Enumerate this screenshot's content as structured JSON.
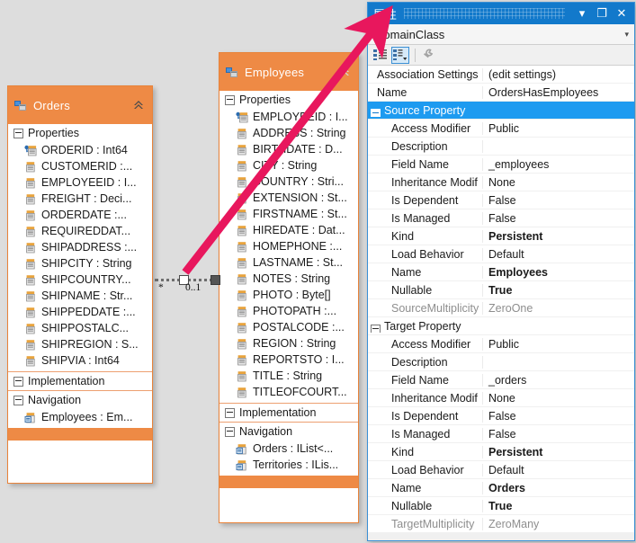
{
  "canvas": {
    "background": "#dddddd",
    "accent_orange": "#ee8a45",
    "accent_blue": "#1279cb",
    "annotation_arrow_color": "#e8175d"
  },
  "orders_class": {
    "title": "Orders",
    "header_icon": "domain-class-icon",
    "collapse_icon": "chevron-double-up-icon",
    "compartments": [
      {
        "label": "Properties",
        "rows": [
          {
            "icon": "key-property-icon",
            "text": "ORDERID : Int64"
          },
          {
            "icon": "property-icon",
            "text": "CUSTOMERID :..."
          },
          {
            "icon": "property-icon",
            "text": "EMPLOYEEID : I..."
          },
          {
            "icon": "property-icon",
            "text": "FREIGHT : Deci..."
          },
          {
            "icon": "property-icon",
            "text": "ORDERDATE  :..."
          },
          {
            "icon": "property-icon",
            "text": "REQUIREDDAT..."
          },
          {
            "icon": "property-icon",
            "text": "SHIPADDRESS  :..."
          },
          {
            "icon": "property-icon",
            "text": "SHIPCITY : String"
          },
          {
            "icon": "property-icon",
            "text": "SHIPCOUNTRY..."
          },
          {
            "icon": "property-icon",
            "text": "SHIPNAME : Str..."
          },
          {
            "icon": "property-icon",
            "text": "SHIPPEDDATE  :..."
          },
          {
            "icon": "property-icon",
            "text": "SHIPPOSTALC..."
          },
          {
            "icon": "property-icon",
            "text": "SHIPREGION : S..."
          },
          {
            "icon": "property-icon",
            "text": "SHIPVIA : Int64"
          }
        ]
      },
      {
        "label": "Implementation",
        "rows": []
      },
      {
        "label": "Navigation",
        "rows": [
          {
            "icon": "navigation-property-icon",
            "text": "Employees : Em..."
          }
        ]
      }
    ]
  },
  "employees_class": {
    "title": "Employees",
    "header_icon": "domain-class-icon",
    "collapse_icon": "chevron-double-up-icon",
    "compartments": [
      {
        "label": "Properties",
        "rows": [
          {
            "icon": "key-property-icon",
            "text": "EMPLOYEEID : I..."
          },
          {
            "icon": "property-icon",
            "text": "ADDRESS : String"
          },
          {
            "icon": "property-icon",
            "text": "BIRTHDATE : D..."
          },
          {
            "icon": "property-icon",
            "text": "CITY : String"
          },
          {
            "icon": "property-icon",
            "text": "COUNTRY : Stri..."
          },
          {
            "icon": "property-icon",
            "text": "EXTENSION : St..."
          },
          {
            "icon": "property-icon",
            "text": "FIRSTNAME : St..."
          },
          {
            "icon": "property-icon",
            "text": "HIREDATE  : Dat..."
          },
          {
            "icon": "property-icon",
            "text": "HOMEPHONE  :..."
          },
          {
            "icon": "property-icon",
            "text": "LASTNAME : St..."
          },
          {
            "icon": "property-icon",
            "text": "NOTES : String"
          },
          {
            "icon": "property-icon",
            "text": "PHOTO : Byte[]"
          },
          {
            "icon": "property-icon",
            "text": "PHOTOPATH  :..."
          },
          {
            "icon": "property-icon",
            "text": "POSTALCODE  :..."
          },
          {
            "icon": "property-icon",
            "text": "REGION : String"
          },
          {
            "icon": "property-icon",
            "text": "REPORTSTO : I..."
          },
          {
            "icon": "property-icon",
            "text": "TITLE : String"
          },
          {
            "icon": "property-icon",
            "text": "TITLEOFCOURT..."
          }
        ]
      },
      {
        "label": "Implementation",
        "rows": []
      },
      {
        "label": "Navigation",
        "rows": [
          {
            "icon": "navigation-property-icon",
            "text": "Orders : IList<..."
          },
          {
            "icon": "navigation-property-icon",
            "text": "Territories : ILis..."
          }
        ]
      }
    ]
  },
  "connector": {
    "source_multiplicity_label": "*",
    "target_multiplicity_label": "0..1"
  },
  "properties_window": {
    "title": "屬性",
    "window_buttons": {
      "dropdown": "▾",
      "maximize": "❐",
      "close": "✕"
    },
    "object_selector": {
      "value": "DomainClass",
      "arrow": "▾"
    },
    "toolbar": [
      {
        "name": "categorized-view-button",
        "selected": false
      },
      {
        "name": "alphabetical-sort-button",
        "selected": true
      },
      {
        "name": "property-pages-button",
        "selected": false
      }
    ],
    "rows": [
      {
        "kind": "prop",
        "top": true,
        "name": "Association Settings",
        "value": "(edit settings)",
        "bold": false,
        "dim": false
      },
      {
        "kind": "prop",
        "top": true,
        "name": "Name",
        "value": "OrdersHasEmployees",
        "bold": false,
        "dim": false
      },
      {
        "kind": "cat",
        "selected": true,
        "name": "Source Property",
        "value": ""
      },
      {
        "kind": "prop",
        "name": "Access Modifier",
        "value": "Public",
        "bold": false,
        "dim": false
      },
      {
        "kind": "prop",
        "name": "Description",
        "value": "",
        "bold": false,
        "dim": false
      },
      {
        "kind": "prop",
        "name": "Field Name",
        "value": "_employees",
        "bold": false,
        "dim": false
      },
      {
        "kind": "prop",
        "name": "Inheritance Modif",
        "value": "None",
        "bold": false,
        "dim": false
      },
      {
        "kind": "prop",
        "name": "Is Dependent",
        "value": "False",
        "bold": false,
        "dim": false
      },
      {
        "kind": "prop",
        "name": "Is Managed",
        "value": "False",
        "bold": false,
        "dim": false
      },
      {
        "kind": "prop",
        "name": "Kind",
        "value": "Persistent",
        "bold": true,
        "dim": false
      },
      {
        "kind": "prop",
        "name": "Load Behavior",
        "value": "Default",
        "bold": false,
        "dim": false
      },
      {
        "kind": "prop",
        "name": "Name",
        "value": "Employees",
        "bold": true,
        "dim": false
      },
      {
        "kind": "prop",
        "name": "Nullable",
        "value": "True",
        "bold": true,
        "dim": false
      },
      {
        "kind": "prop",
        "name": "SourceMultiplicity",
        "value": "ZeroOne",
        "bold": false,
        "dim": true
      },
      {
        "kind": "cat",
        "selected": false,
        "name": "Target Property",
        "value": ""
      },
      {
        "kind": "prop",
        "name": "Access Modifier",
        "value": "Public",
        "bold": false,
        "dim": false
      },
      {
        "kind": "prop",
        "name": "Description",
        "value": "",
        "bold": false,
        "dim": false
      },
      {
        "kind": "prop",
        "name": "Field Name",
        "value": "_orders",
        "bold": false,
        "dim": false
      },
      {
        "kind": "prop",
        "name": "Inheritance Modif",
        "value": "None",
        "bold": false,
        "dim": false
      },
      {
        "kind": "prop",
        "name": "Is Dependent",
        "value": "False",
        "bold": false,
        "dim": false
      },
      {
        "kind": "prop",
        "name": "Is Managed",
        "value": "False",
        "bold": false,
        "dim": false
      },
      {
        "kind": "prop",
        "name": "Kind",
        "value": "Persistent",
        "bold": true,
        "dim": false
      },
      {
        "kind": "prop",
        "name": "Load Behavior",
        "value": "Default",
        "bold": false,
        "dim": false
      },
      {
        "kind": "prop",
        "name": "Name",
        "value": "Orders",
        "bold": true,
        "dim": false
      },
      {
        "kind": "prop",
        "name": "Nullable",
        "value": "True",
        "bold": true,
        "dim": false
      },
      {
        "kind": "prop",
        "name": "TargetMultiplicity",
        "value": "ZeroMany",
        "bold": false,
        "dim": true
      }
    ]
  }
}
